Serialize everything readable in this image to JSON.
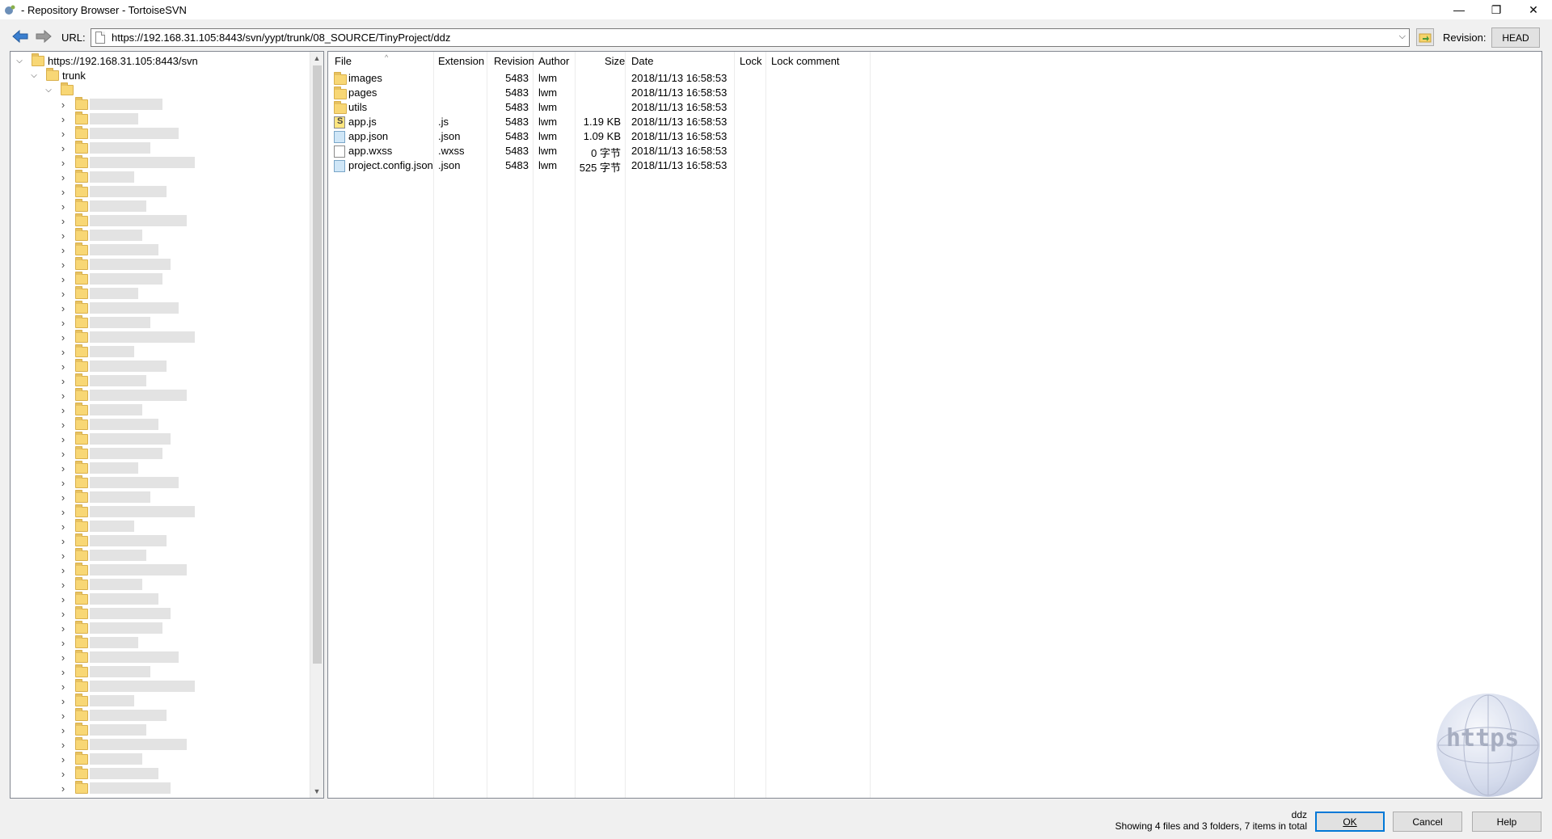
{
  "window": {
    "title": "- Repository Browser - TortoiseSVN",
    "minimize_glyph": "—",
    "restore_glyph": "❐",
    "close_glyph": "✕"
  },
  "toolbar": {
    "url_label": "URL:",
    "url_value": "https://192.168.31.105:8443/svn/yypt/trunk/08_SOURCE/TinyProject/ddz",
    "revision_label": "Revision:",
    "revision_value": "HEAD"
  },
  "tree": {
    "root_label": "https://192.168.31.105:8443/svn",
    "trunk_label": "trunk"
  },
  "list": {
    "columns": [
      "File",
      "Extension",
      "Revision",
      "Author",
      "Size",
      "Date",
      "Lock",
      "Lock comment"
    ],
    "rows": [
      {
        "name": "images",
        "ext": "",
        "rev": "5483",
        "author": "lwm",
        "size": "",
        "date": "2018/11/13 16:58:53",
        "kind": "folder"
      },
      {
        "name": "pages",
        "ext": "",
        "rev": "5483",
        "author": "lwm",
        "size": "",
        "date": "2018/11/13 16:58:53",
        "kind": "folder"
      },
      {
        "name": "utils",
        "ext": "",
        "rev": "5483",
        "author": "lwm",
        "size": "",
        "date": "2018/11/13 16:58:53",
        "kind": "folder"
      },
      {
        "name": "app.js",
        "ext": ".js",
        "rev": "5483",
        "author": "lwm",
        "size": "1.19 KB",
        "date": "2018/11/13 16:58:53",
        "kind": "js"
      },
      {
        "name": "app.json",
        "ext": ".json",
        "rev": "5483",
        "author": "lwm",
        "size": "1.09 KB",
        "date": "2018/11/13 16:58:53",
        "kind": "json"
      },
      {
        "name": "app.wxss",
        "ext": ".wxss",
        "rev": "5483",
        "author": "lwm",
        "size": "0 字节",
        "date": "2018/11/13 16:58:53",
        "kind": "file"
      },
      {
        "name": "project.config.json",
        "ext": ".json",
        "rev": "5483",
        "author": "lwm",
        "size": "525 字节",
        "date": "2018/11/13 16:58:53",
        "kind": "json"
      }
    ]
  },
  "watermark": {
    "text": "https"
  },
  "footer": {
    "current_folder": "ddz",
    "status": "Showing 4 files and 3 folders, 7 items in total",
    "ok_label": "OK",
    "cancel_label": "Cancel",
    "help_label": "Help"
  }
}
